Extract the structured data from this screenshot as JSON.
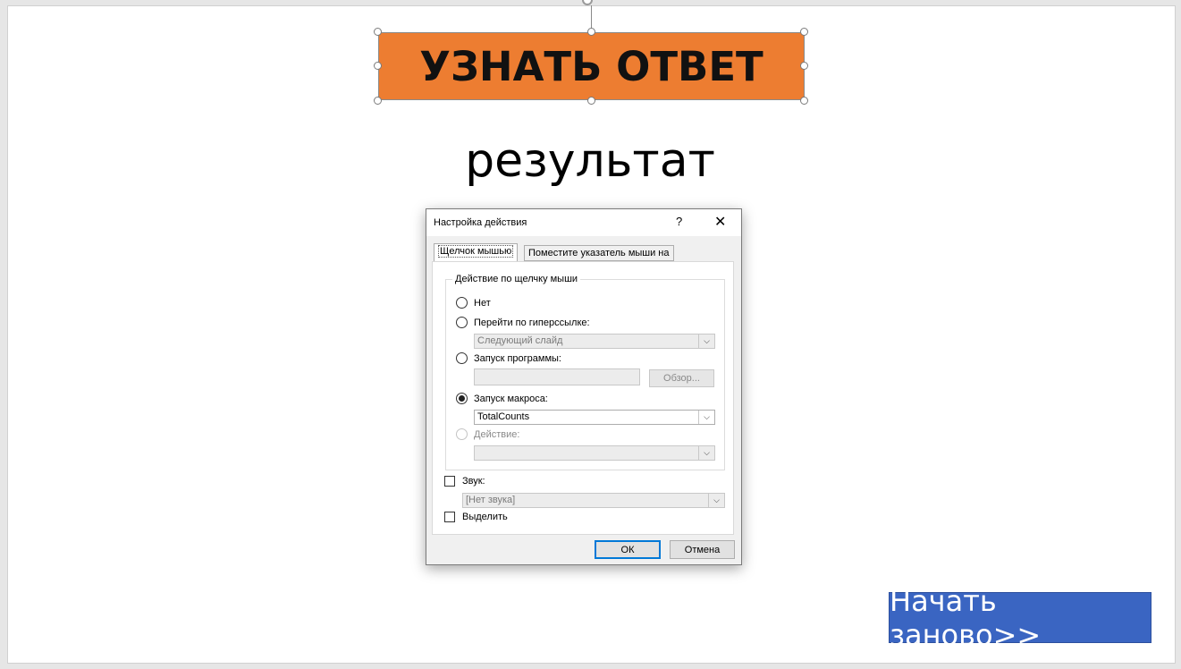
{
  "slide": {
    "action_button_label": "УЗНАТЬ ОТВЕТ",
    "result_text": "результат",
    "restart_button_label": "Начать заново>>"
  },
  "dialog": {
    "title": "Настройка действия",
    "help_glyph": "?",
    "close_glyph": "✕",
    "tabs": [
      "Щелчок мышью",
      "Поместите указатель мыши на"
    ],
    "group_label": "Действие по щелчку мыши",
    "options": {
      "none": "Нет",
      "hyperlink": "Перейти по гиперссылке:",
      "hyperlink_value": "Следующий слайд",
      "run_program": "Запуск программы:",
      "browse_button": "Обзор...",
      "run_macro": "Запуск макроса:",
      "macro_value": "TotalCounts",
      "object_action": "Действие:",
      "object_action_value": ""
    },
    "selected_option": "run_macro",
    "sound_label": "Звук:",
    "sound_value": "[Нет звука]",
    "highlight_label": "Выделить",
    "ok_button": "ОК",
    "cancel_button": "Отмена"
  },
  "colors": {
    "orange_button": "#ed7d31",
    "blue_button": "#3a65c2",
    "default_button_border": "#0078d7"
  }
}
